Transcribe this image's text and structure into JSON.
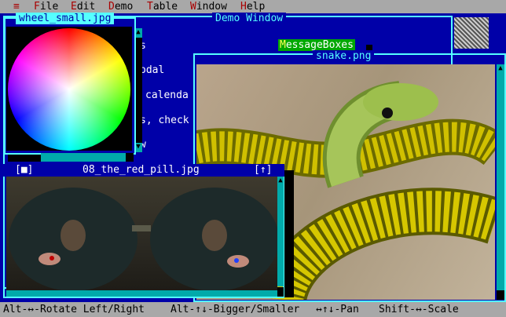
{
  "menu": {
    "system": "≡",
    "items": [
      {
        "hot": "F",
        "rest": "ile"
      },
      {
        "hot": "E",
        "rest": "dit"
      },
      {
        "hot": "D",
        "rest": "emo"
      },
      {
        "hot": "T",
        "rest": "able"
      },
      {
        "hot": "W",
        "rest": "indow"
      },
      {
        "hot": "H",
        "rest": "elp"
      }
    ]
  },
  "demo_window": {
    "title": "Demo Window",
    "list_fragments": [
      "s",
      "odal",
      "calenda",
      "s, check",
      "w"
    ],
    "selected_hot": "M",
    "selected_rest": "essageBoxes"
  },
  "wheel_window": {
    "title": "wheel_small.jpg"
  },
  "snake_window": {
    "title": "snake.png"
  },
  "pill_window": {
    "title": "08_the_red_pill.jpg",
    "close_btn": "[■]",
    "zoom_btn": "[↑]"
  },
  "status": {
    "rotate": "Alt-↔-Rotate Left/Right",
    "size": "Alt-↑↓-Bigger/Smaller",
    "pan": "↔↑↓-Pan",
    "scale": "Shift-↔-Scale"
  }
}
